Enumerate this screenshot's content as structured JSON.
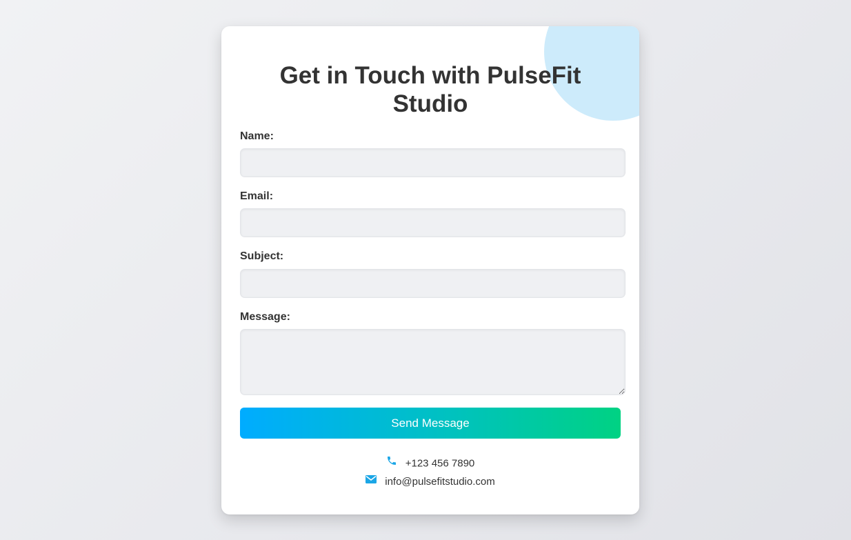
{
  "form": {
    "title_line1": "Get in Touch with PulseFit",
    "title_line2": "Studio",
    "fields": {
      "name": {
        "label": "Name:",
        "value": "",
        "placeholder": ""
      },
      "email": {
        "label": "Email:",
        "value": "",
        "placeholder": ""
      },
      "subject": {
        "label": "Subject:",
        "value": "",
        "placeholder": ""
      },
      "message": {
        "label": "Message:",
        "value": "",
        "placeholder": ""
      }
    },
    "submit_label": "Send Message"
  },
  "contact": {
    "phone": {
      "icon": "phone-icon",
      "text": "+123 456 7890"
    },
    "email": {
      "icon": "envelope-icon",
      "text": "info@pulsefitstudio.com"
    }
  },
  "colors": {
    "accent": "#1ba6e6",
    "button_gradient_start": "#00acff",
    "button_gradient_end": "#00d283",
    "decor_circle": "#cdebfb"
  }
}
